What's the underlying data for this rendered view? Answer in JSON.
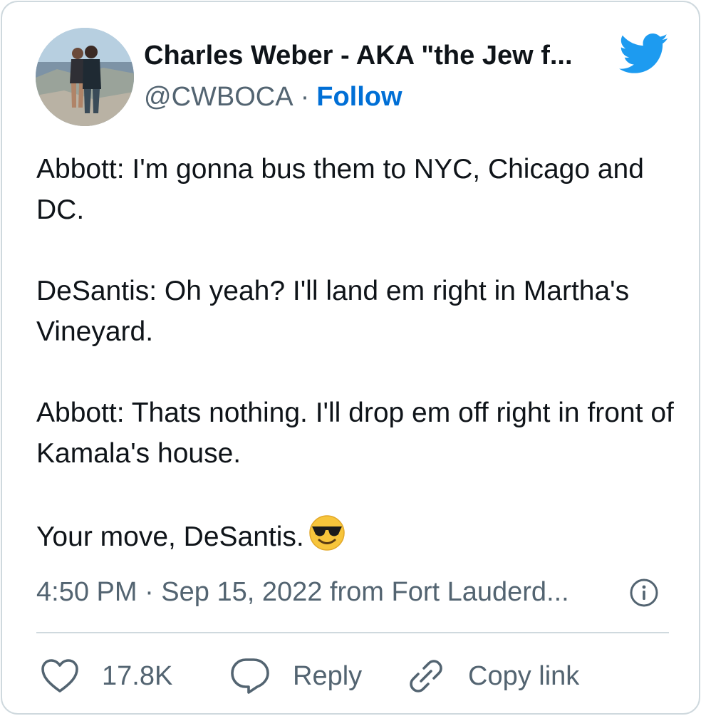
{
  "author": {
    "display_name": "Charles Weber - AKA \"the Jew f...",
    "handle": "@CWBOCA",
    "separator": "·",
    "follow_label": "Follow",
    "avatar_icon": "profile-photo"
  },
  "tweet": {
    "paragraphs": [
      "Abbott: I'm gonna bus them to NYC, Chicago and DC.",
      "DeSantis: Oh yeah? I'll land em right in Martha's Vineyard.",
      "Abbott: Thats nothing. I'll drop em off right in front of Kamala's house.",
      "Your move, DeSantis."
    ],
    "emoji_icon": "smiling-face-with-sunglasses-icon"
  },
  "meta": {
    "timestamp": "4:50 PM · Sep 15, 2022 from Fort Lauderd..."
  },
  "actions": {
    "likes_count": "17.8K",
    "reply_label": "Reply",
    "copy_link_label": "Copy link"
  },
  "colors": {
    "brand": "#1d9bf0",
    "link": "#006fd6",
    "secondary_text": "#536471",
    "border": "#cfd9de",
    "primary_text": "#0f1419"
  },
  "icons": [
    "twitter-bird-icon",
    "info-icon",
    "heart-icon",
    "reply-bubble-icon",
    "link-icon"
  ]
}
